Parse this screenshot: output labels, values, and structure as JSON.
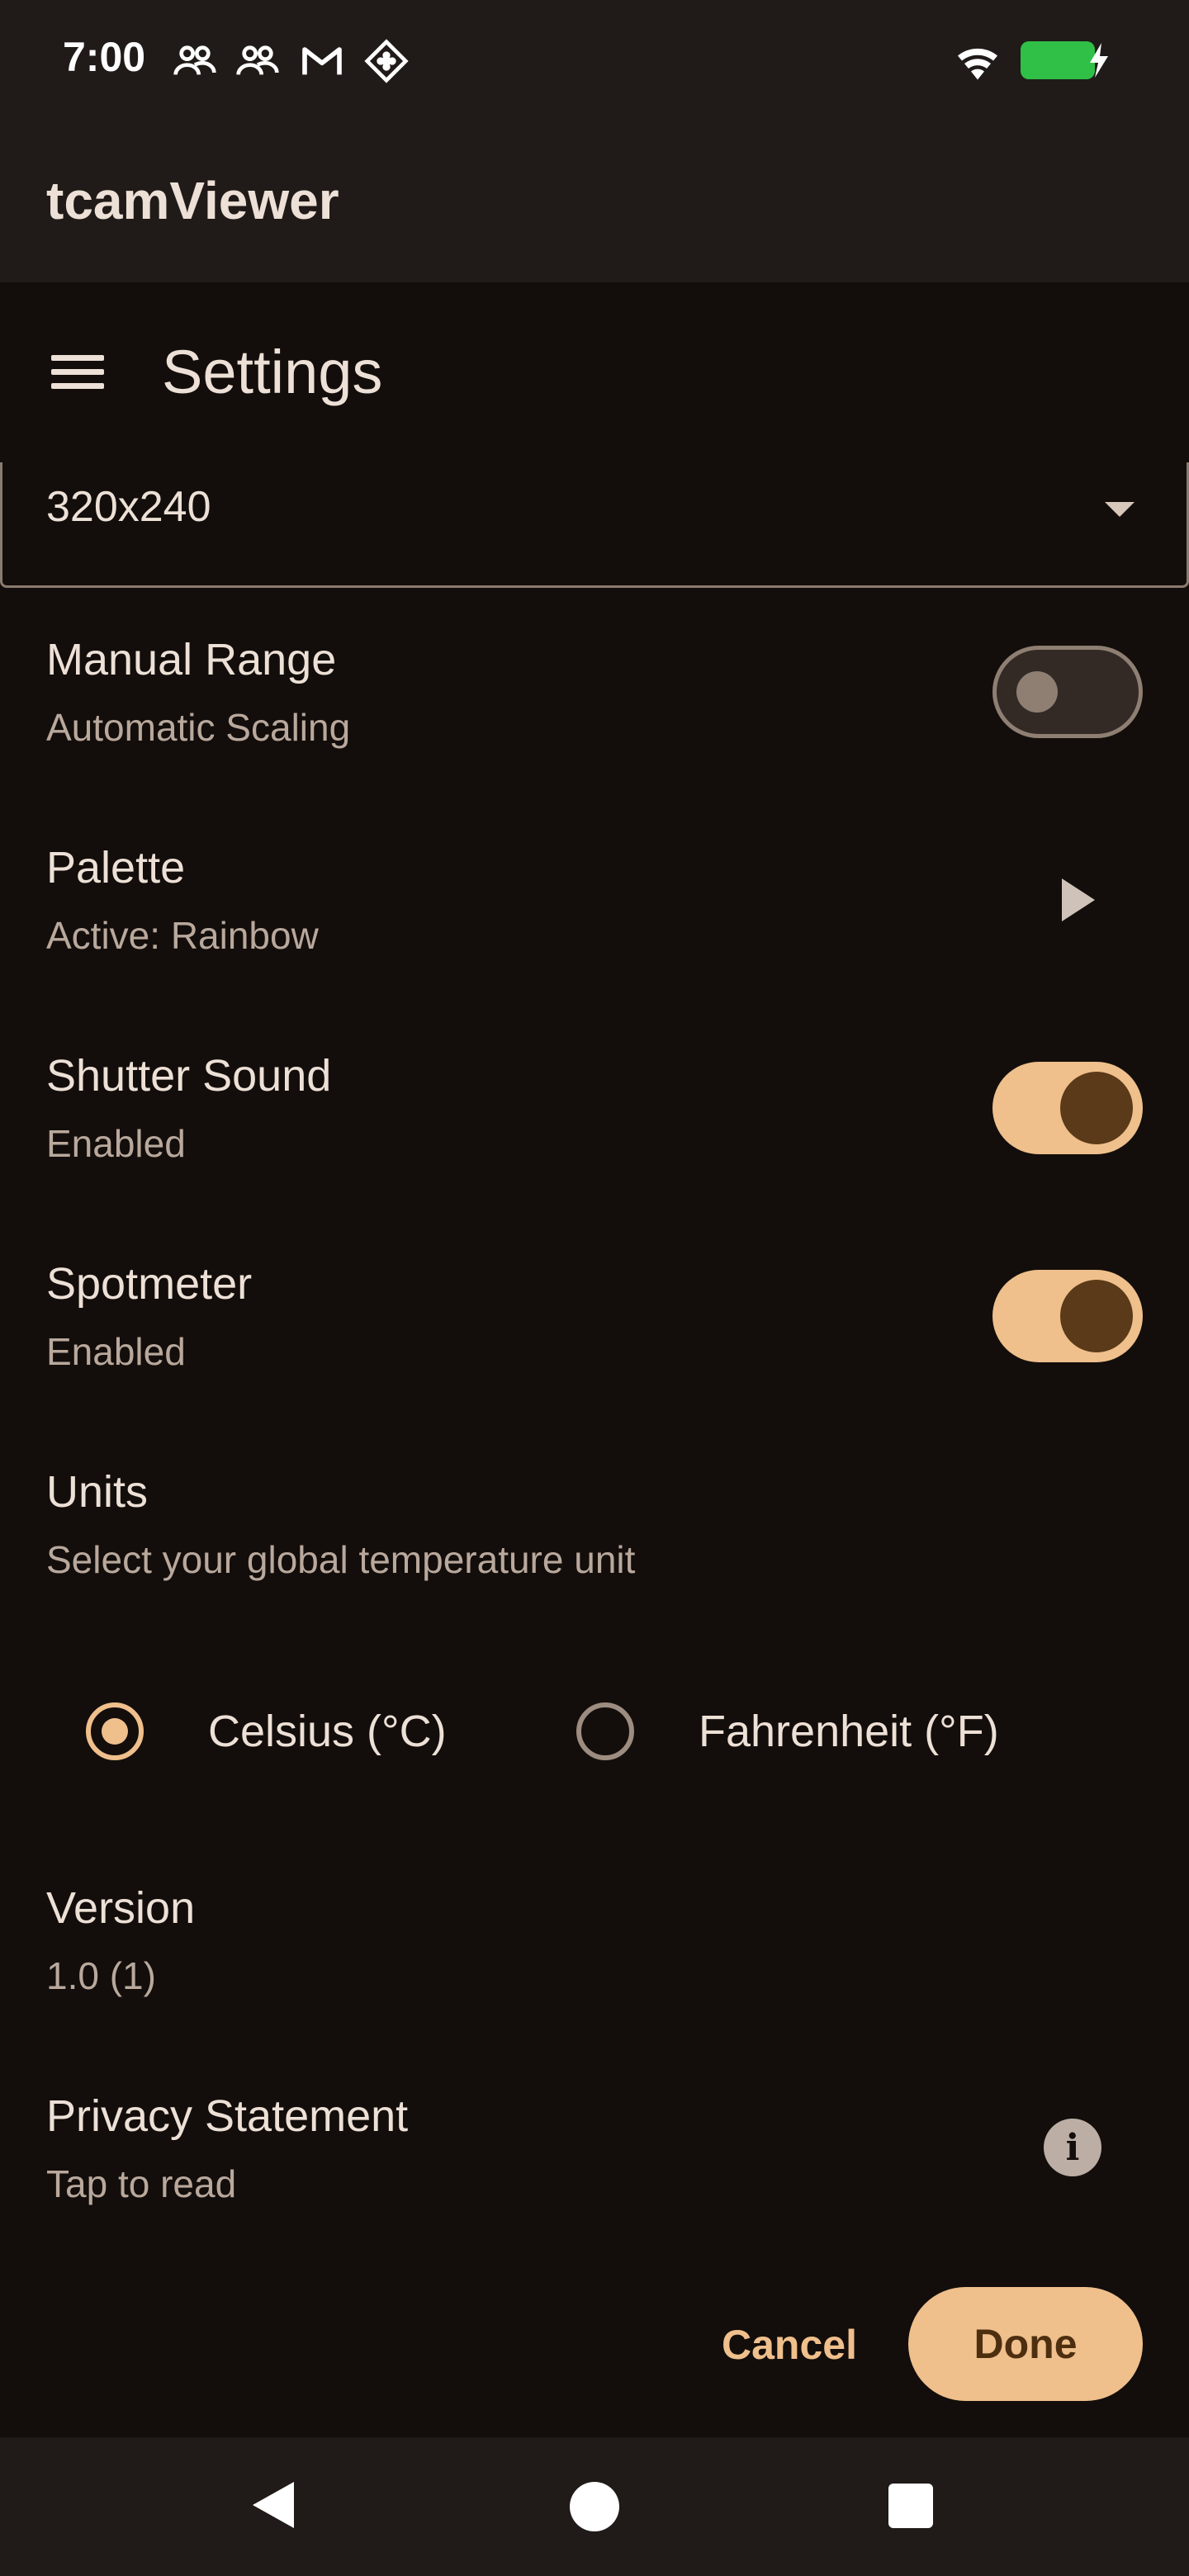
{
  "status_bar": {
    "time": "7:00",
    "icons": [
      "people-icon",
      "people-icon",
      "gmail-icon",
      "app-icon",
      "wifi-icon",
      "battery-charging-icon"
    ],
    "battery_color": "#30c048"
  },
  "app_bar": {
    "title": "tcamViewer"
  },
  "dialog": {
    "title": "Settings",
    "resolution": {
      "value": "320x240"
    },
    "manual_range": {
      "title": "Manual Range",
      "subtitle": "Automatic Scaling",
      "enabled": false
    },
    "palette": {
      "title": "Palette",
      "subtitle": "Active: Rainbow"
    },
    "shutter_sound": {
      "title": "Shutter Sound",
      "subtitle": "Enabled",
      "enabled": true
    },
    "spotmeter": {
      "title": "Spotmeter",
      "subtitle": "Enabled",
      "enabled": true
    },
    "units": {
      "title": "Units",
      "subtitle": "Select your global temperature unit",
      "options": [
        {
          "label": "Celsius (°C)",
          "selected": true
        },
        {
          "label": "Fahrenheit (°F)",
          "selected": false
        }
      ]
    },
    "version": {
      "title": "Version",
      "value": "1.0 (1)"
    },
    "privacy": {
      "title": "Privacy Statement",
      "subtitle": "Tap to read",
      "icon_text": "i"
    },
    "buttons": {
      "cancel": "Cancel",
      "done": "Done"
    }
  },
  "colors": {
    "accent": "#efbf8c",
    "background": "#130e0b",
    "surface": "#201b18",
    "text_primary": "#ede0d6",
    "text_secondary": "#b9a89c"
  },
  "nav_bar": {
    "icons": [
      "back-icon",
      "home-icon",
      "recents-icon"
    ]
  }
}
